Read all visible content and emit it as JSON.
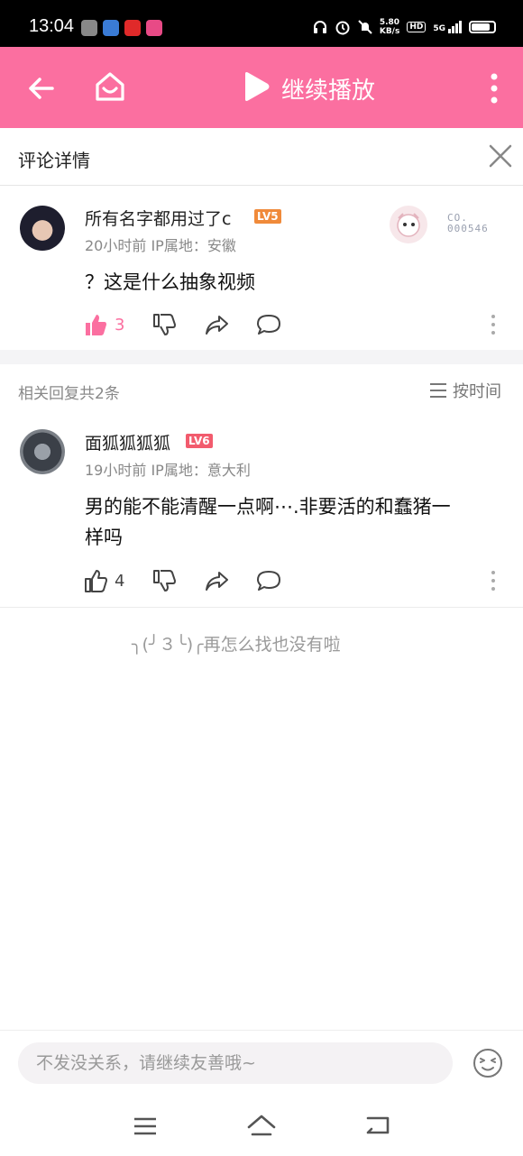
{
  "status": {
    "time": "13:04",
    "net_speed": "5.80\nKB/s",
    "net_speed_top": "5.80",
    "net_speed_bottom": "KB/s",
    "hd": "HD",
    "signal": "5G"
  },
  "header": {
    "title": "继续播放",
    "accent_color": "#fb6fa0"
  },
  "detail": {
    "title": "评论详情"
  },
  "main_comment": {
    "username": "所有名字都用过了c",
    "level": "LV5",
    "level_color": "#f08a3a",
    "meta": "20小时前 IP属地：安徽",
    "text": "？这是什么抽象视频",
    "likes": "3",
    "liked": true,
    "deco_text_1": "CO.",
    "deco_text_2": "000546"
  },
  "replies": {
    "header": "相关回复共2条",
    "sort_label": "按时间",
    "items": [
      {
        "username": "面狐狐狐狐",
        "level": "LV6",
        "level_color": "#f25b6d",
        "meta": "19小时前 IP属地：意大利",
        "text_line1": "男的能不能清醒一点啊⋯.非要活的和蠢猪一",
        "text_line2": "样吗",
        "likes": "4"
      }
    ]
  },
  "end_message": "╮(╯３╰)╭再怎么找也没有啦",
  "input": {
    "placeholder": "不发没关系，请继续友善哦~"
  }
}
